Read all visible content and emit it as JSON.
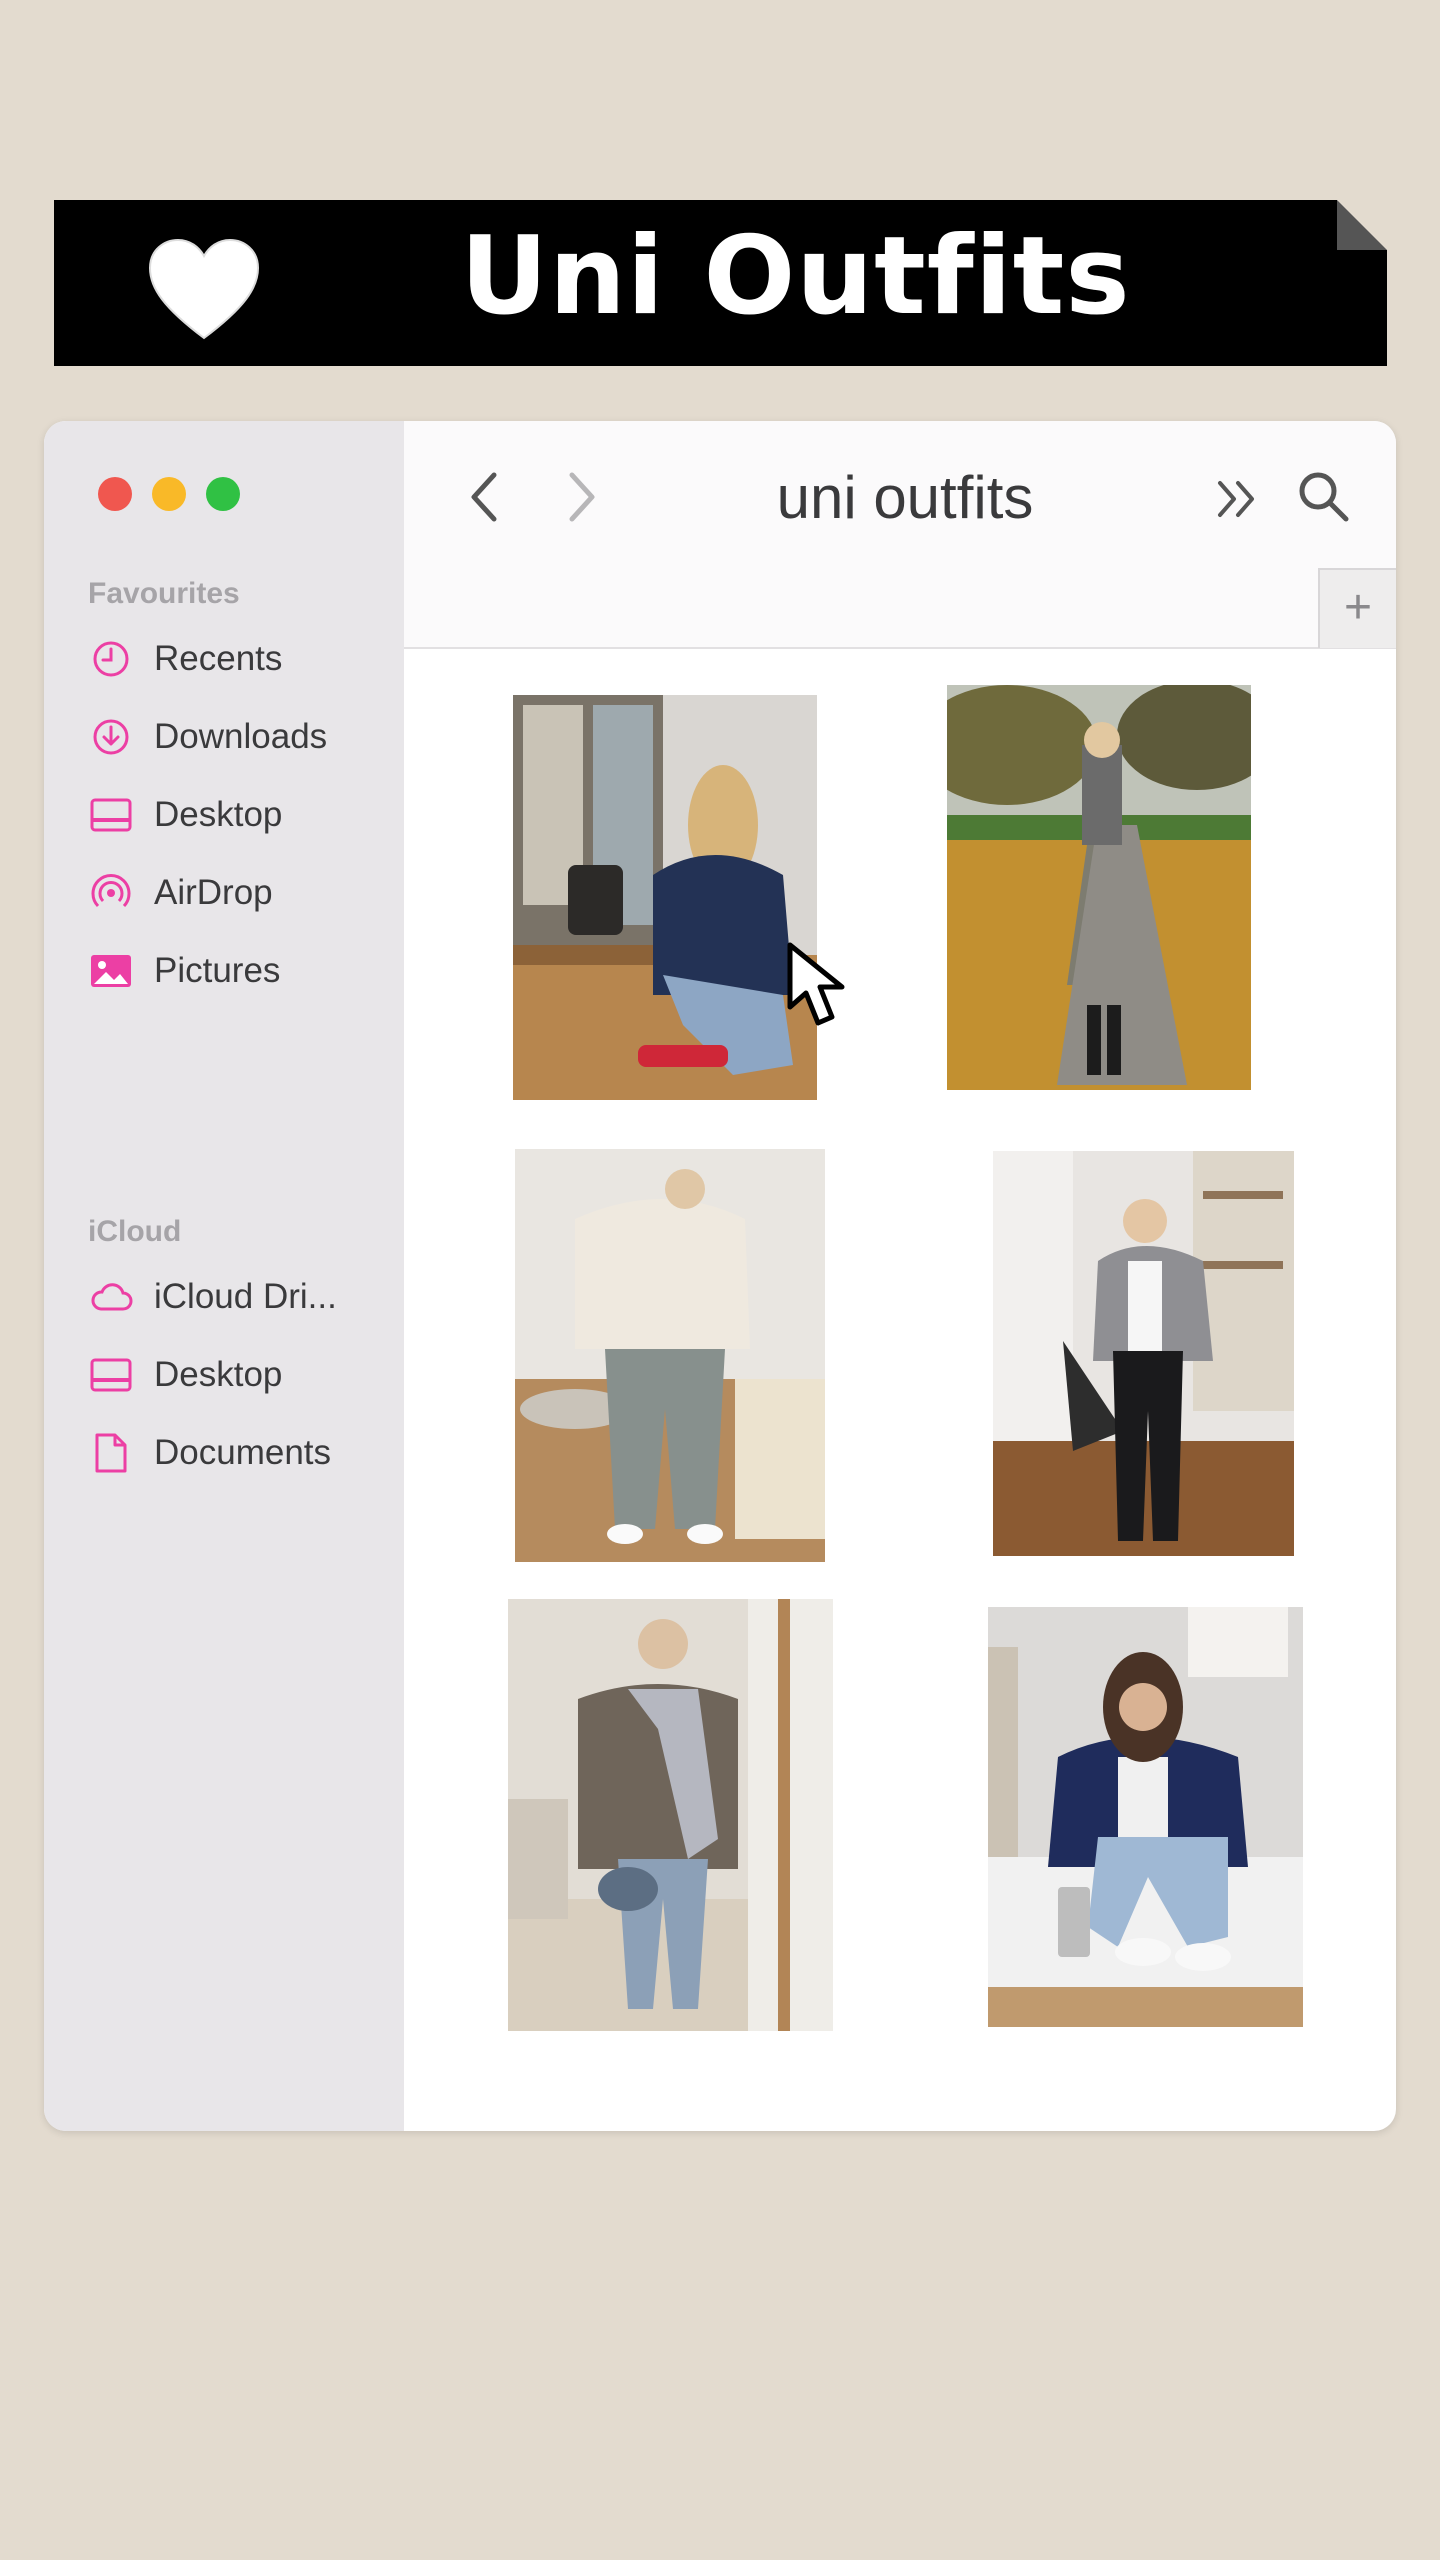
{
  "banner": {
    "title": "Uni Outfits",
    "icon": "heart-icon"
  },
  "window": {
    "title": "uni outfits",
    "traffic_lights": [
      "#f0574f",
      "#f9b928",
      "#30c144"
    ],
    "accent_color": "#ec3fa4",
    "sidebar": {
      "favourites_label": "Favourites",
      "favourites": [
        {
          "label": "Recents",
          "icon": "clock-icon"
        },
        {
          "label": "Downloads",
          "icon": "download-icon"
        },
        {
          "label": "Desktop",
          "icon": "desktop-icon"
        },
        {
          "label": "AirDrop",
          "icon": "airdrop-icon"
        },
        {
          "label": "Pictures",
          "icon": "pictures-icon"
        }
      ],
      "icloud_label": "iCloud",
      "icloud": [
        {
          "label": "iCloud Dri...",
          "icon": "cloud-icon"
        },
        {
          "label": "Desktop",
          "icon": "desktop-icon"
        },
        {
          "label": "Documents",
          "icon": "document-icon"
        }
      ]
    },
    "toolbar": {
      "back": "chevron-left-icon",
      "forward": "chevron-right-icon",
      "more": "double-chevron-icon",
      "search": "search-icon",
      "new_tab": "+"
    },
    "photos": [
      "outfit photo: navy sweater, light jeans, red sneakers at cafe window",
      "outfit photo: long grey coat, mini skirt, black boots in autumn park",
      "outfit photo: cream knit sweater, baggy light jeans, white sneakers",
      "outfit photo: grey blazer, white tee, black trousers",
      "outfit photo: brown jacket, plaid scarf, blue jeans mirror selfie",
      "outfit photo: navy bomber jacket, light baggy jeans on bed"
    ]
  }
}
